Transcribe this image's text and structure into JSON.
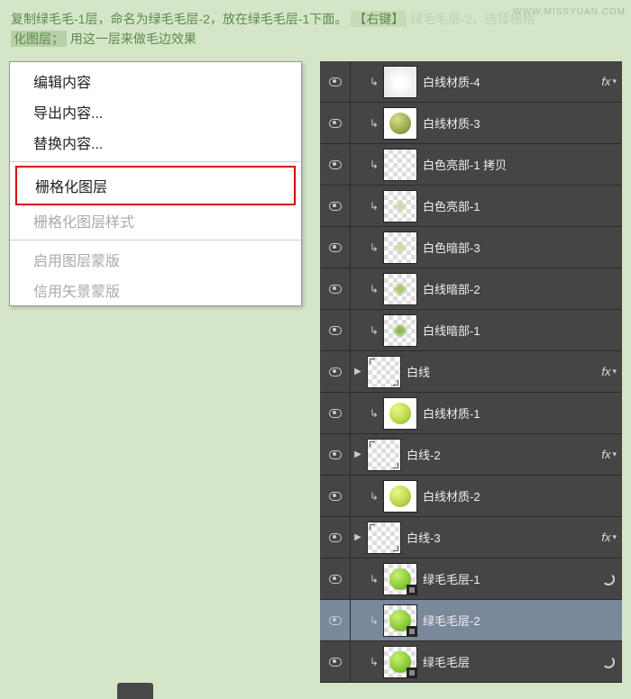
{
  "watermark": "WWW.MISSYUAN.COM",
  "instruction": {
    "part1": "复制绿毛毛-1层，命名为绿毛毛层-2，放在绿毛毛层-1下面。",
    "btn": "【右键】",
    "hidden": "绿毛毛层-2，选择栅格",
    "part2_a": "化图层；",
    "part2_b": "用这一层来做毛边效果"
  },
  "menu": {
    "edit_content": "编辑内容",
    "export_content": "导出内容...",
    "replace_content": "替换内容...",
    "rasterize_layer": "栅格化图层",
    "rasterize_style": "栅格化图层样式",
    "enable_mask": "启用图层蒙版",
    "enable_vector": "信用矢景蒙版"
  },
  "layers": [
    {
      "name": "白线材质-4",
      "thumb": "white-grad",
      "clip": true,
      "fx": true,
      "indent": 1
    },
    {
      "name": "白线材质-3",
      "thumb": "olive-sphere",
      "clip": true,
      "indent": 1
    },
    {
      "name": "白色亮部-1 拷贝",
      "thumb": "checker",
      "clip": true,
      "indent": 1
    },
    {
      "name": "白色亮部-1",
      "thumb": "checker-faint",
      "clip": true,
      "indent": 1
    },
    {
      "name": "白色暗部-3",
      "thumb": "checker-faint",
      "clip": true,
      "indent": 1
    },
    {
      "name": "白线暗部-2",
      "thumb": "checker-med",
      "clip": true,
      "indent": 1
    },
    {
      "name": "白线暗部-1",
      "thumb": "checker-strong",
      "clip": true,
      "indent": 1
    },
    {
      "name": "白线",
      "thumb": "corners",
      "expand": true,
      "fx": true,
      "indent": 0
    },
    {
      "name": "白线材质-1",
      "thumb": "lime-sphere",
      "clip": true,
      "indent": 1
    },
    {
      "name": "白线-2",
      "thumb": "corners",
      "expand": true,
      "fx": true,
      "indent": 0
    },
    {
      "name": "白线材质-2",
      "thumb": "lime-sphere",
      "clip": true,
      "indent": 1
    },
    {
      "name": "白线-3",
      "thumb": "corners",
      "expand": true,
      "fx": true,
      "indent": 0
    },
    {
      "name": "绿毛毛层-1",
      "thumb": "green-smart",
      "clip": true,
      "filter": true,
      "indent": 1
    },
    {
      "name": "绿毛毛层-2",
      "thumb": "green-smart",
      "clip": true,
      "selected": true,
      "indent": 1
    },
    {
      "name": "绿毛毛层",
      "thumb": "green-smart",
      "clip": true,
      "filter": true,
      "indent": 1
    }
  ],
  "fx_label": "fx"
}
